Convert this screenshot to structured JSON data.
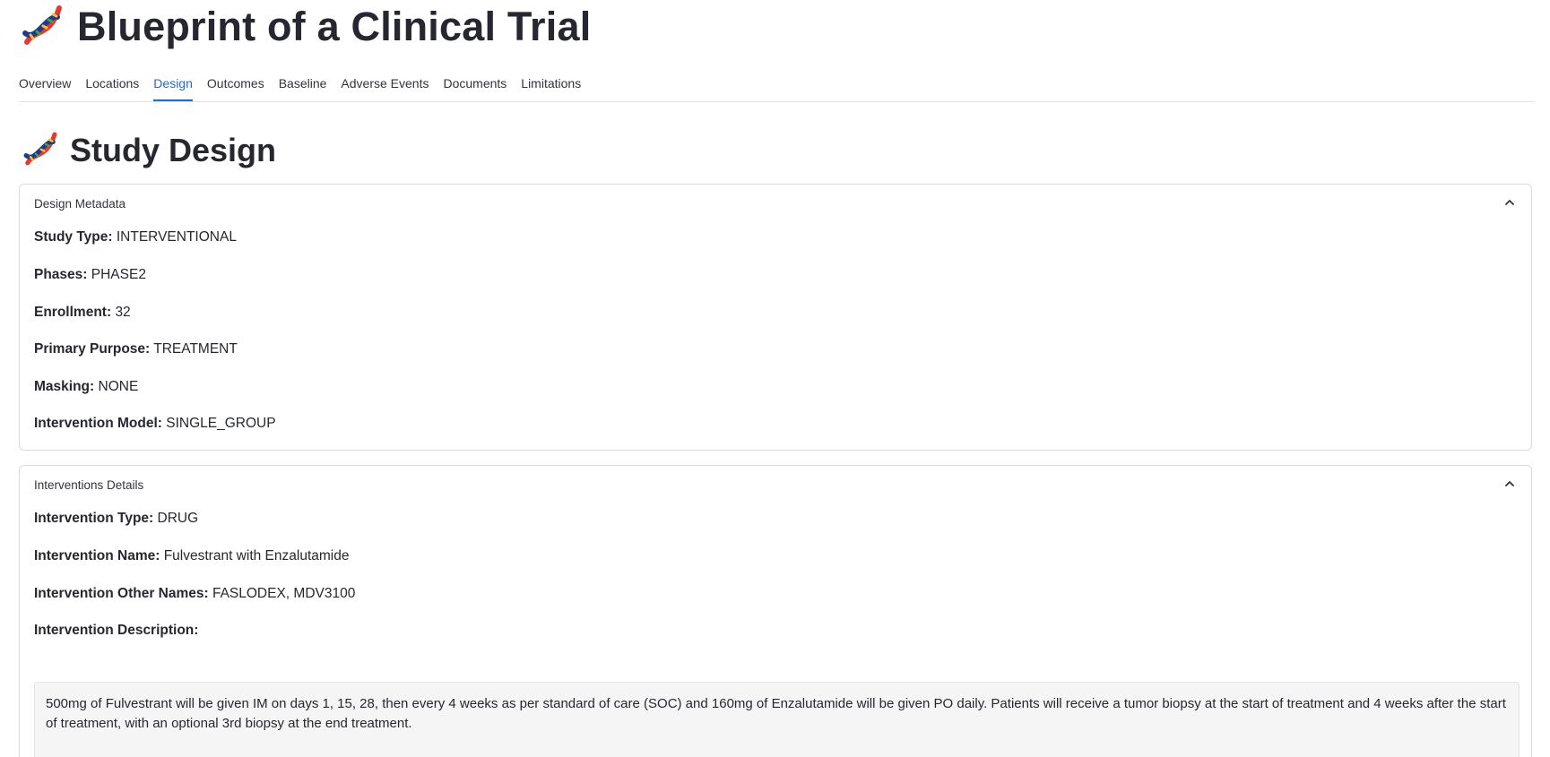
{
  "app": {
    "title": "Blueprint of a Clinical Trial",
    "icon": "dna-icon"
  },
  "tabs": [
    {
      "label": "Overview",
      "active": false
    },
    {
      "label": "Locations",
      "active": false
    },
    {
      "label": "Design",
      "active": true
    },
    {
      "label": "Outcomes",
      "active": false
    },
    {
      "label": "Baseline",
      "active": false
    },
    {
      "label": "Adverse Events",
      "active": false
    },
    {
      "label": "Documents",
      "active": false
    },
    {
      "label": "Limitations",
      "active": false
    }
  ],
  "section": {
    "title": "Study Design",
    "icon": "dna-icon"
  },
  "design_metadata": {
    "heading": "Design Metadata",
    "expanded": true,
    "fields": [
      {
        "label": "Study Type:",
        "value": "INTERVENTIONAL"
      },
      {
        "label": "Phases:",
        "value": "PHASE2"
      },
      {
        "label": "Enrollment:",
        "value": "32"
      },
      {
        "label": "Primary Purpose:",
        "value": "TREATMENT"
      },
      {
        "label": "Masking:",
        "value": "NONE"
      },
      {
        "label": "Intervention Model:",
        "value": "SINGLE_GROUP"
      }
    ]
  },
  "interventions": {
    "heading": "Interventions Details",
    "expanded": true,
    "fields": [
      {
        "label": "Intervention Type:",
        "value": "DRUG"
      },
      {
        "label": "Intervention Name:",
        "value": "Fulvestrant with Enzalutamide"
      },
      {
        "label": "Intervention Other Names:",
        "value": "FASLODEX, MDV3100"
      },
      {
        "label": "Intervention Description:",
        "value": ""
      }
    ],
    "description": "500mg of Fulvestrant will be given IM on days 1, 15, 28, then every 4 weeks as per standard of care (SOC) and 160mg of Enzalutamide will be given PO daily. Patients will receive a tumor biopsy at the start of treatment and 4 weeks after the start of treatment, with an optional 3rd biopsy at the end treatment."
  },
  "colors": {
    "accent": "#1c6bd6",
    "text": "#262730",
    "border": "#d8dbe2",
    "code_bg": "#f5f5f6"
  }
}
